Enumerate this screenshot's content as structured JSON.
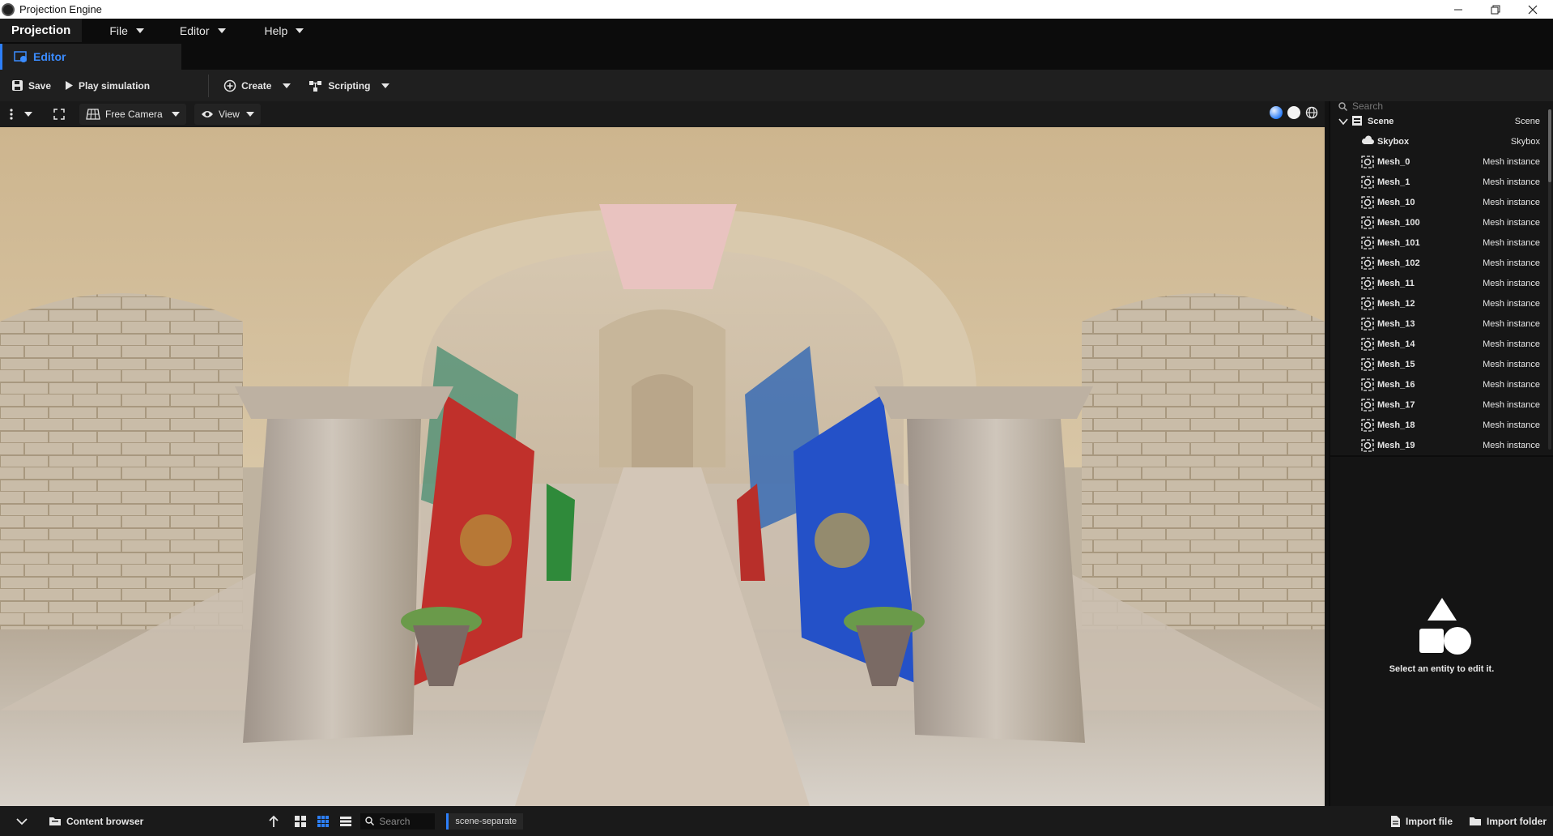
{
  "window": {
    "title": "Projection Engine"
  },
  "menubar": {
    "brand": "Projection",
    "items": [
      "File",
      "Editor",
      "Help"
    ]
  },
  "tabs": {
    "active_label": "Editor"
  },
  "toolbar": {
    "save_label": "Save",
    "play_label": "Play simulation",
    "create_label": "Create",
    "scripting_label": "Scripting"
  },
  "viewport_toolbar": {
    "camera_label": "Free Camera",
    "view_label": "View"
  },
  "hierarchy": {
    "search_placeholder": "Search",
    "root": {
      "name": "Scene",
      "type": "Scene"
    },
    "items": [
      {
        "name": "Skybox",
        "type": "Skybox",
        "icon": "cloud-icon"
      },
      {
        "name": "Mesh_0",
        "type": "Mesh instance",
        "icon": "mesh-icon"
      },
      {
        "name": "Mesh_1",
        "type": "Mesh instance",
        "icon": "mesh-icon"
      },
      {
        "name": "Mesh_10",
        "type": "Mesh instance",
        "icon": "mesh-icon"
      },
      {
        "name": "Mesh_100",
        "type": "Mesh instance",
        "icon": "mesh-icon"
      },
      {
        "name": "Mesh_101",
        "type": "Mesh instance",
        "icon": "mesh-icon"
      },
      {
        "name": "Mesh_102",
        "type": "Mesh instance",
        "icon": "mesh-icon"
      },
      {
        "name": "Mesh_11",
        "type": "Mesh instance",
        "icon": "mesh-icon"
      },
      {
        "name": "Mesh_12",
        "type": "Mesh instance",
        "icon": "mesh-icon"
      },
      {
        "name": "Mesh_13",
        "type": "Mesh instance",
        "icon": "mesh-icon"
      },
      {
        "name": "Mesh_14",
        "type": "Mesh instance",
        "icon": "mesh-icon"
      },
      {
        "name": "Mesh_15",
        "type": "Mesh instance",
        "icon": "mesh-icon"
      },
      {
        "name": "Mesh_16",
        "type": "Mesh instance",
        "icon": "mesh-icon"
      },
      {
        "name": "Mesh_17",
        "type": "Mesh instance",
        "icon": "mesh-icon"
      },
      {
        "name": "Mesh_18",
        "type": "Mesh instance",
        "icon": "mesh-icon"
      },
      {
        "name": "Mesh_19",
        "type": "Mesh instance",
        "icon": "mesh-icon"
      }
    ]
  },
  "inspector": {
    "empty_message": "Select an entity to edit it."
  },
  "bottombar": {
    "content_browser_label": "Content browser",
    "search_placeholder": "Search",
    "current_folder": "scene-separate",
    "import_file_label": "Import file",
    "import_folder_label": "Import folder"
  },
  "colors": {
    "accent": "#2d7ff9",
    "background": "#121212",
    "panel": "#161616"
  }
}
